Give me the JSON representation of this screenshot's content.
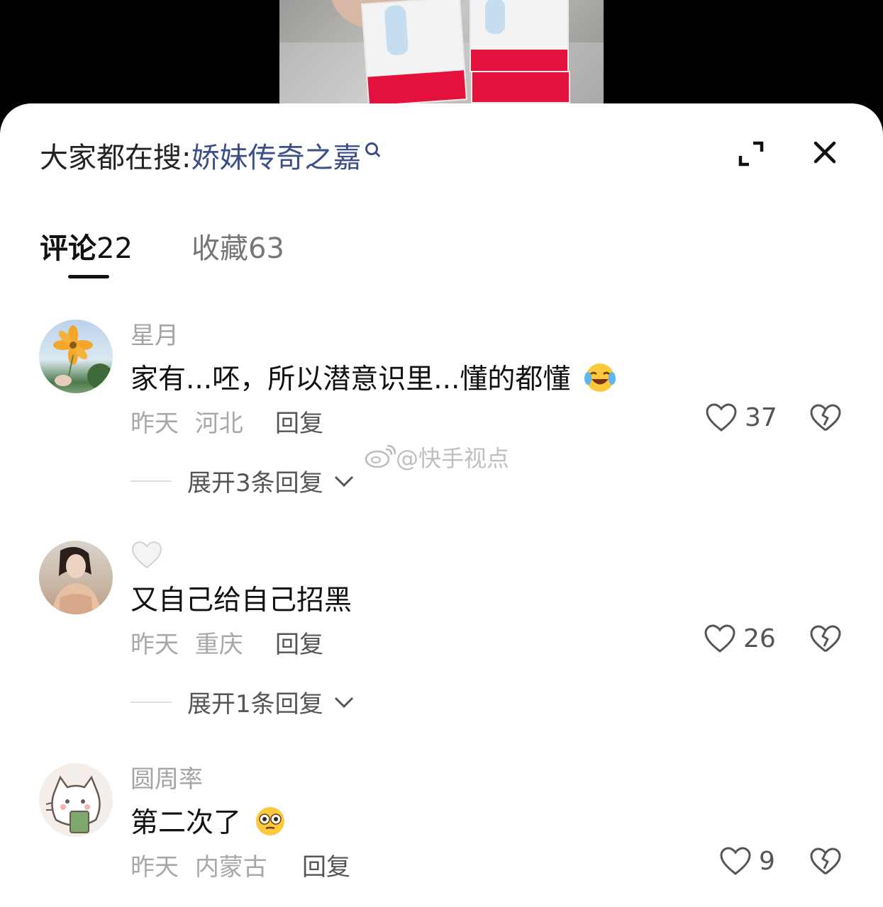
{
  "header": {
    "search_prefix": "大家都在搜:",
    "search_term": "娇妹传奇之嘉"
  },
  "tabs": [
    {
      "label": "评论",
      "count": "22",
      "active": true
    },
    {
      "label": "收藏",
      "count": "63",
      "active": false
    }
  ],
  "watermark": "@快手视点",
  "comments": [
    {
      "username": "星月",
      "text": "家有...呸，所以潜意识里...懂的都懂",
      "emoji": "laughing-tears",
      "time": "昨天",
      "location": "河北",
      "reply_label": "回复",
      "likes": "37",
      "expand_label": "展开3条回复"
    },
    {
      "username": "🤍",
      "text": "又自己给自己招黑",
      "time": "昨天",
      "location": "重庆",
      "reply_label": "回复",
      "likes": "26",
      "expand_label": "展开1条回复"
    },
    {
      "username": "圆周率",
      "text": "第二次了",
      "emoji": "flushed",
      "time": "昨天",
      "location": "内蒙古",
      "reply_label": "回复",
      "likes": "9"
    }
  ],
  "colors": {
    "search_term": "#3b4f88",
    "muted": "#a4a4a4",
    "text": "#111111"
  }
}
